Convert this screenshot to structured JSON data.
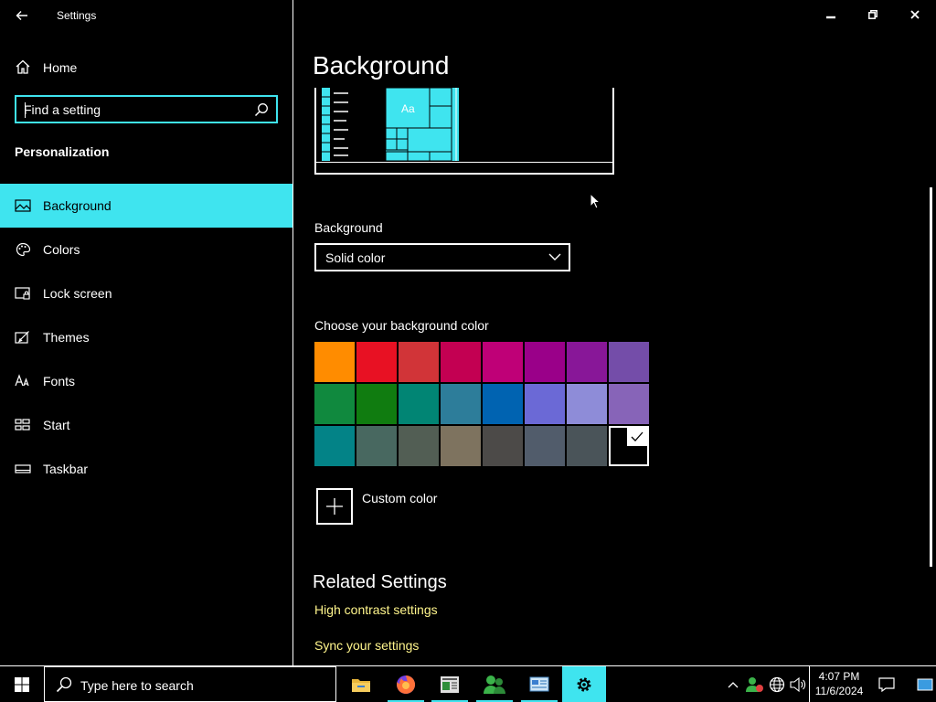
{
  "window": {
    "app_title": "Settings",
    "icons": {
      "back": "back-arrow-icon",
      "minimize": "minimize-icon",
      "maximize": "restore-icon",
      "close": "close-icon"
    }
  },
  "sidebar": {
    "home_label": "Home",
    "search_placeholder": "Find a setting",
    "section_heading": "Personalization",
    "items": [
      {
        "label": "Background",
        "icon": "picture-icon",
        "selected": true
      },
      {
        "label": "Colors",
        "icon": "palette-icon",
        "selected": false
      },
      {
        "label": "Lock screen",
        "icon": "lock-screen-icon",
        "selected": false
      },
      {
        "label": "Themes",
        "icon": "themes-icon",
        "selected": false
      },
      {
        "label": "Fonts",
        "icon": "fonts-icon",
        "selected": false
      },
      {
        "label": "Start",
        "icon": "start-icon",
        "selected": false
      },
      {
        "label": "Taskbar",
        "icon": "taskbar-icon",
        "selected": false
      }
    ]
  },
  "main": {
    "page_title": "Background",
    "preview_text": "Aa",
    "background_label": "Background",
    "background_dropdown_value": "Solid color",
    "color_label": "Choose your background color",
    "swatches": [
      "#ff8c00",
      "#e81123",
      "#d13438",
      "#c30052",
      "#bf0077",
      "#9a0089",
      "#881798",
      "#744da9",
      "#10893e",
      "#107c10",
      "#018574",
      "#2d7d9a",
      "#0063b1",
      "#6b69d6",
      "#8e8cd8",
      "#8764b8",
      "#038387",
      "#486860",
      "#525e54",
      "#7e735f",
      "#4c4a48",
      "#515c6b",
      "#4a5459",
      "#000000"
    ],
    "selected_swatch_index": 23,
    "custom_color_label": "Custom color",
    "related_heading": "Related Settings",
    "related_links": [
      "High contrast settings",
      "Sync your settings"
    ]
  },
  "taskbar": {
    "search_text": "Type here to search",
    "apps": [
      {
        "icon": "file-explorer-icon",
        "active": false
      },
      {
        "icon": "firefox-icon",
        "active": false
      },
      {
        "icon": "news-app-icon",
        "active": false
      },
      {
        "icon": "people-app-icon",
        "active": false
      },
      {
        "icon": "control-panel-icon",
        "active": false
      },
      {
        "icon": "settings-gear-icon",
        "active": true
      }
    ],
    "time": "4:07 PM",
    "date": "11/6/2024"
  },
  "colors": {
    "accent": "#3fe4ef",
    "link": "#fff58c",
    "background": "#000000",
    "text": "#ffffff"
  }
}
